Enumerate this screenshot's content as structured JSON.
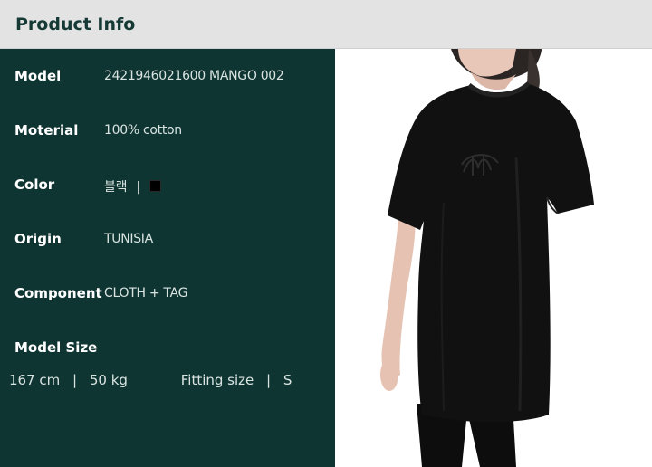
{
  "header": {
    "title": "Product Info"
  },
  "specs": [
    {
      "label": "Model",
      "value": "2421946021600 MANGO 002"
    },
    {
      "label": "Moterial",
      "value": "100% cotton"
    },
    {
      "label": "Color",
      "value": "블랙",
      "separator": "|",
      "swatch_color": "#000000"
    },
    {
      "label": "Origin",
      "value": "TUNISIA"
    },
    {
      "label": "Component",
      "value": "CLOTH + TAG"
    }
  ],
  "model_size": {
    "label": "Model Size",
    "height": "167 cm",
    "sep1": "|",
    "weight": "50 kg",
    "fitting_label": "Fitting size",
    "sep2": "|",
    "fitting_value": "S"
  },
  "colors": {
    "panel_bg": "#0f3533",
    "header_bg": "#e3e3e3",
    "header_text": "#153a35",
    "shirt": "#111111"
  },
  "photo": {
    "subject": "model-wearing-black-tshirt"
  }
}
